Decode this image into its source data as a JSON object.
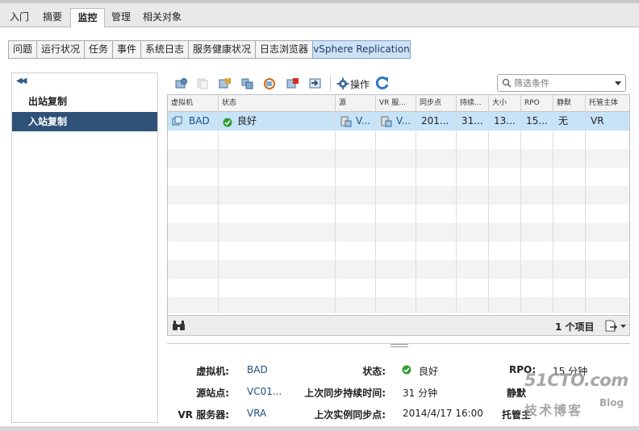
{
  "nav": {
    "tabs": [
      "入门",
      "摘要",
      "监控",
      "管理",
      "相关对象"
    ],
    "active": 2
  },
  "subtabs": {
    "items": [
      "问题",
      "运行状况",
      "任务",
      "事件",
      "系统日志",
      "服务健康状况",
      "日志浏览器",
      "vSphere Replication"
    ],
    "active": 7
  },
  "left_panel": {
    "items": [
      "出站复制",
      "入站复制"
    ],
    "selected": 1
  },
  "toolbar": {
    "actions_label": "操作",
    "search_placeholder": "筛选条件"
  },
  "grid": {
    "columns": [
      "虚拟机",
      "状态",
      "源",
      "VR 服...",
      "同步点",
      "持续...",
      "大小",
      "RPO",
      "静默",
      "托管主体"
    ],
    "rows": [
      {
        "vm": "BAD",
        "status": "良好",
        "source": "V...",
        "vr_server": "V...",
        "sync_point": "201...",
        "duration": "31...",
        "size": "13...",
        "rpo": "15...",
        "quiesce": "无",
        "host": "VR"
      }
    ],
    "footer_count": "1 个项目"
  },
  "details": {
    "vm_label": "虚拟机:",
    "vm_value": "BAD",
    "status_label": "状态:",
    "status_value": "良好",
    "rpo_label": "RPO:",
    "rpo_value": "15 分钟",
    "source_label": "源站点:",
    "source_value": "VC01...",
    "last_sync_duration_label": "上次同步持续时间:",
    "last_sync_duration_value": "31 分钟",
    "quiesce_label": "静默",
    "vr_server_label": "VR 服务器:",
    "vr_server_value": "VRA",
    "last_instance_sync_label": "上次实例同步点:",
    "last_instance_sync_value": "2014/4/17 16:00",
    "host_label": "托管主"
  },
  "watermark": {
    "line1": "51CTO.com",
    "line2": "技术博客",
    "line3": "Blog"
  },
  "colors": {
    "selected_row": "#c6e3f7",
    "left_selected": "#2e5277",
    "status_ok": "#2f9e32",
    "link": "#1f4f7e",
    "refresh": "#2b78c5"
  }
}
